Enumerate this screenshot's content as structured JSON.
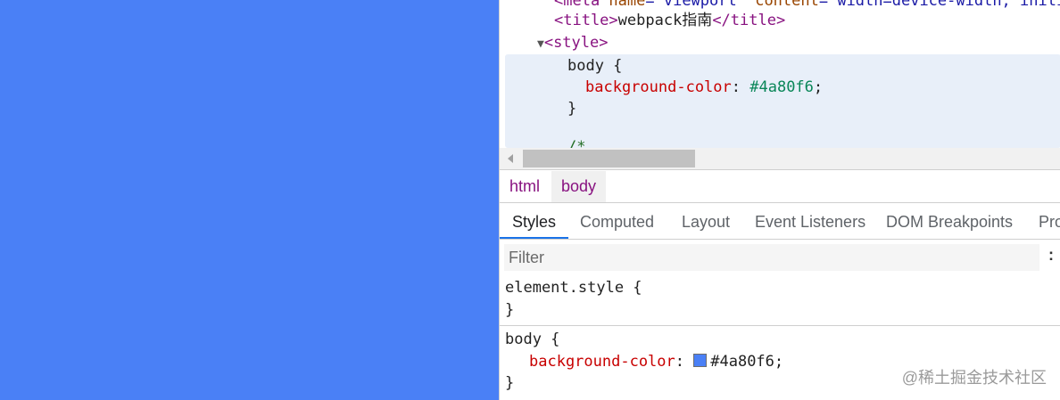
{
  "page": {
    "background": "#4a80f6"
  },
  "elements_tree": {
    "meta_line": {
      "tag": "<meta",
      "attr1_name": " name",
      "attr1_value": "=\"viewport\"",
      "attr2_name": " content",
      "attr2_value": "=\"width=device-width, initial"
    },
    "title_line": {
      "open": "<title>",
      "text": "webpack指南",
      "close": "</title>"
    },
    "style_line": {
      "toggle": "▼",
      "open": "<style>"
    },
    "css": {
      "selector": "body {",
      "property": "background-color",
      "colon": ": ",
      "value": "#4a80f6",
      "semicolon": ";",
      "close": "}",
      "comment": "/*"
    }
  },
  "breadcrumb": [
    "html",
    "body"
  ],
  "tabs": [
    "Styles",
    "Computed",
    "Layout",
    "Event Listeners",
    "DOM Breakpoints",
    "Pro"
  ],
  "active_tab": "Styles",
  "filter": {
    "placeholder": "Filter",
    "more": ":"
  },
  "styles_pane": {
    "element_style": {
      "selector": "element.style {",
      "close": "}"
    },
    "body_rule": {
      "selector": "body {",
      "property": "background-color",
      "colon": ": ",
      "value": "#4a80f6",
      "semicolon": ";",
      "close": "}"
    }
  },
  "watermark": "@稀土掘金技术社区",
  "colors": {
    "accent": "#1a73e8",
    "tag": "#881280",
    "property": "#c80000",
    "swatch": "#4a80f6"
  }
}
